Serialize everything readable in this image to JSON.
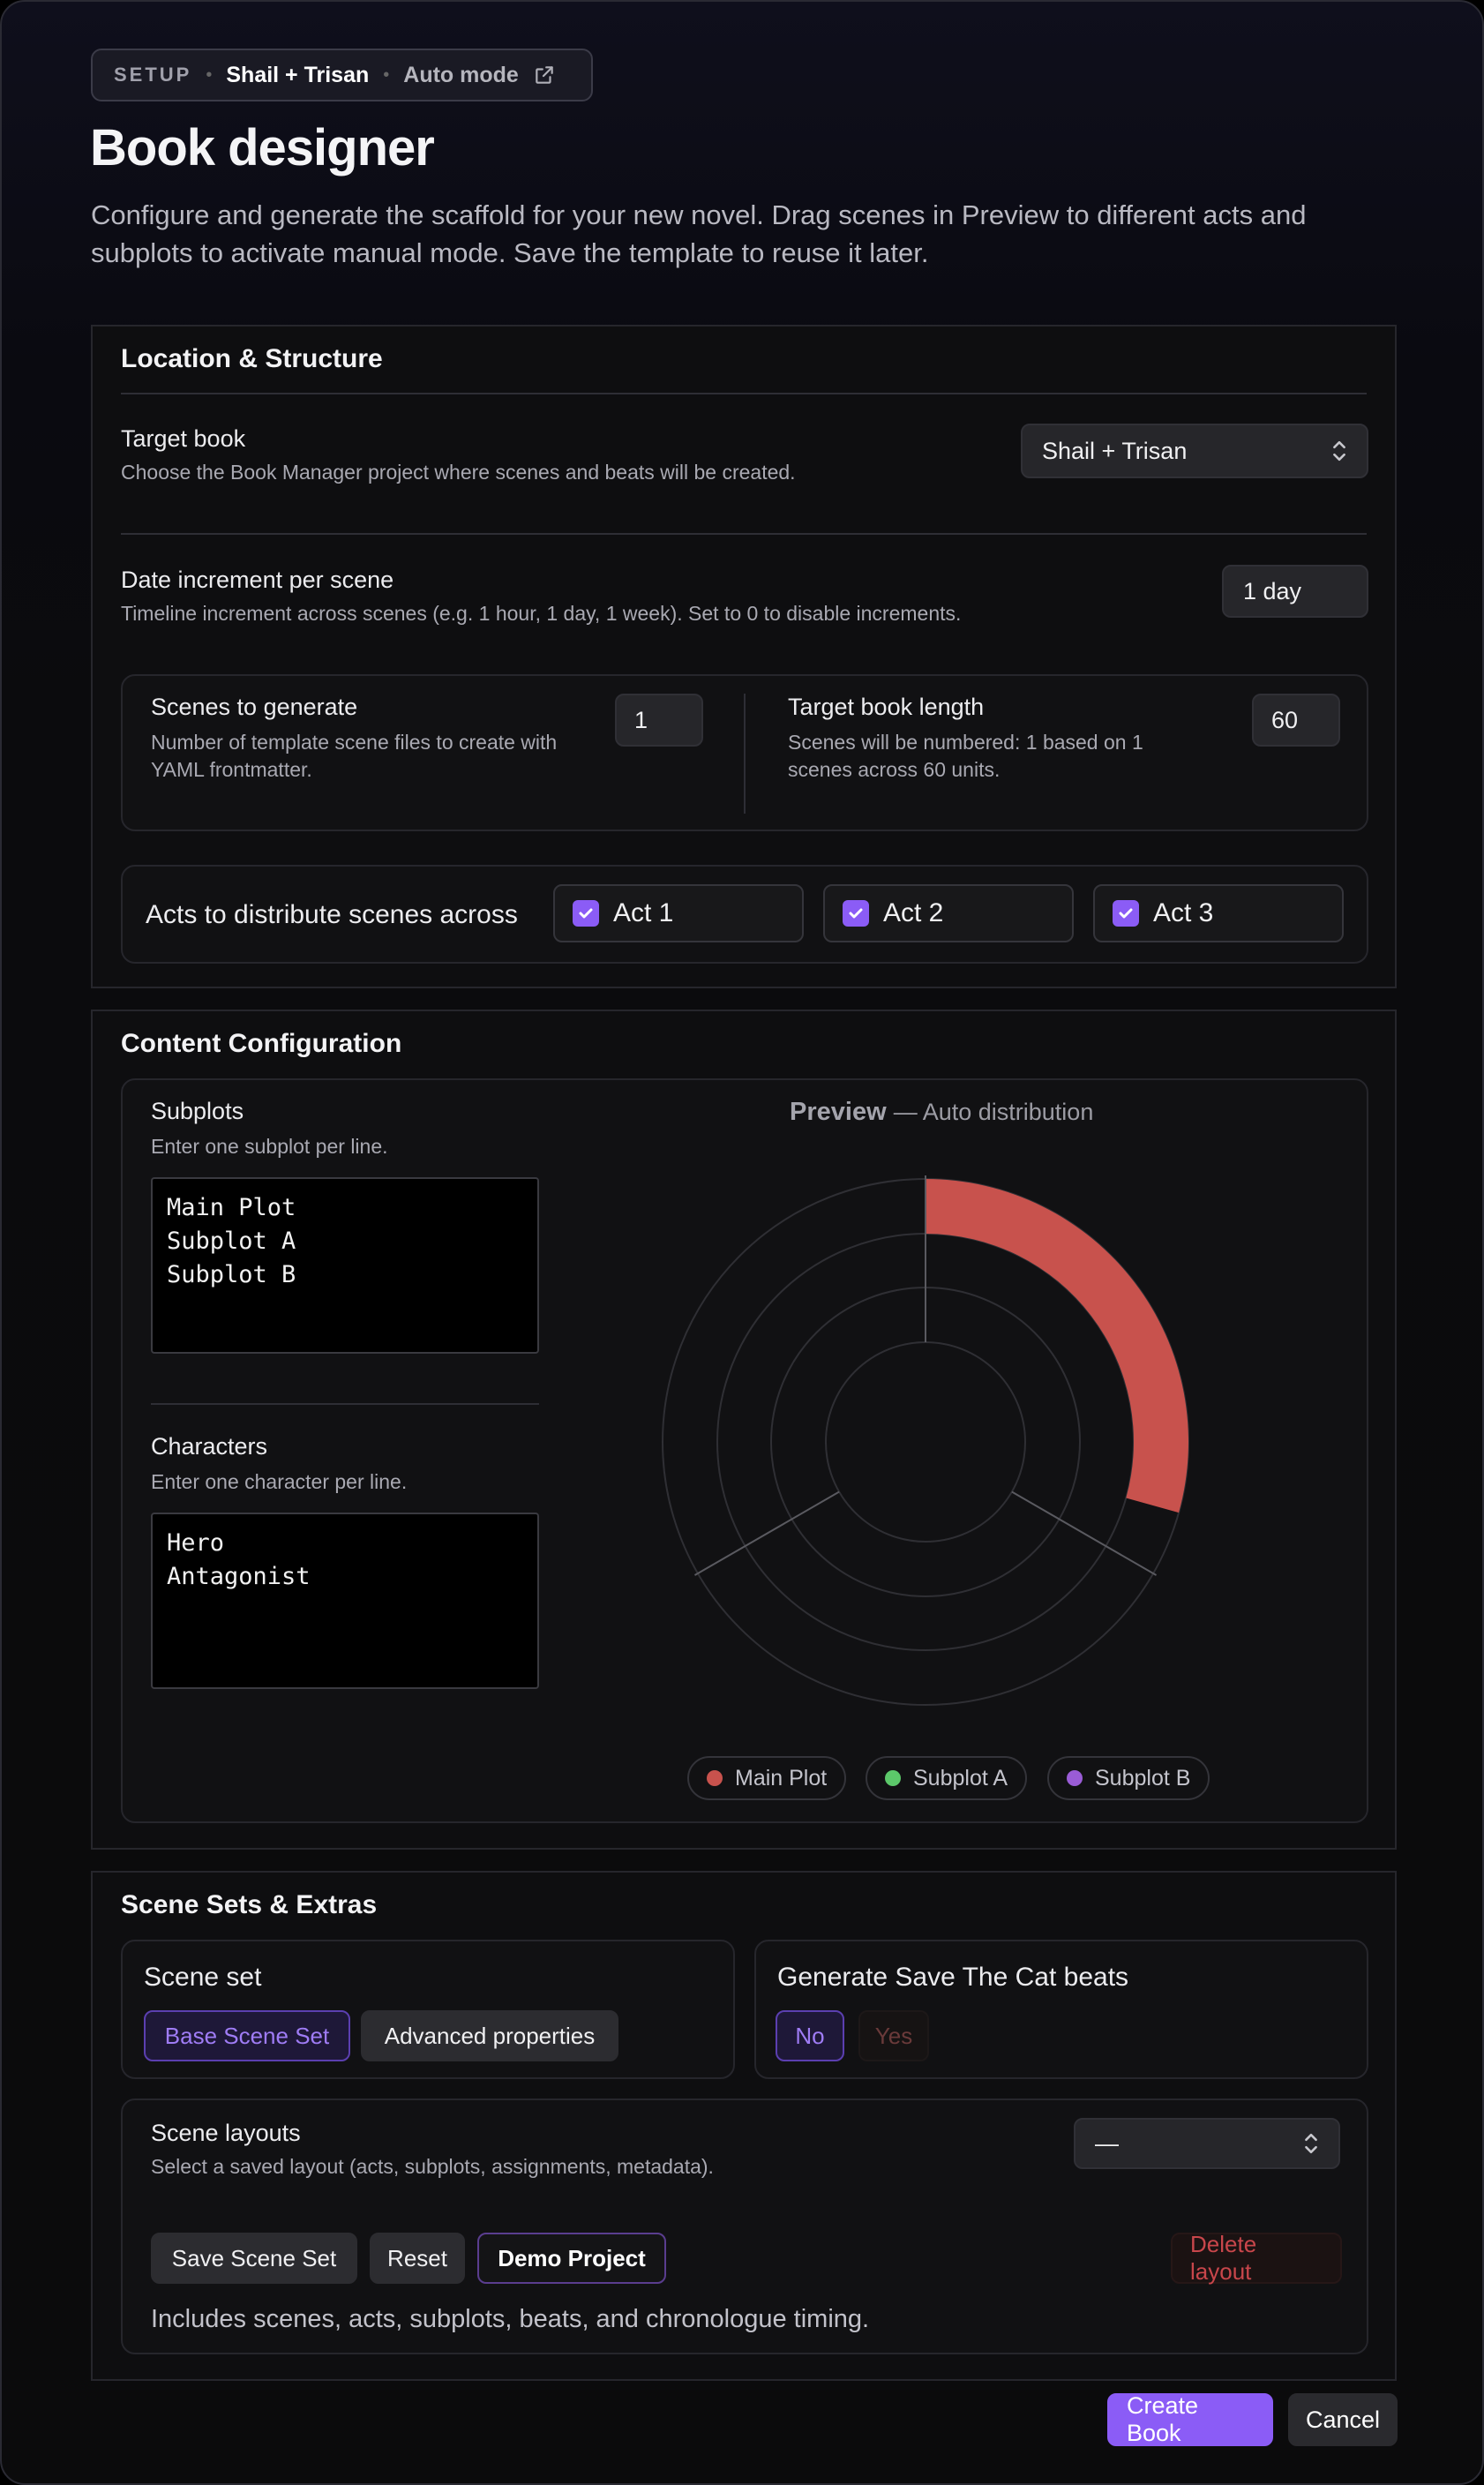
{
  "header": {
    "badge_setup": "SETUP",
    "badge_book": "Shail + Trisan",
    "badge_mode": "Auto mode",
    "title": "Book designer",
    "description": "Configure and generate the scaffold for your new novel. Drag scenes in Preview to different acts and subplots to activate manual mode. Save the template to reuse it later."
  },
  "location": {
    "title": "Location & Structure",
    "target_book_label": "Target book",
    "target_book_help": "Choose the Book Manager project where scenes and beats will be created.",
    "target_book_value": "Shail + Trisan",
    "date_inc_label": "Date increment per scene",
    "date_inc_help": "Timeline increment across scenes (e.g. 1 hour, 1 day, 1 week). Set to 0 to disable increments.",
    "date_inc_value": "1 day",
    "scenes_label": "Scenes to generate",
    "scenes_help": "Number of template scene files to create with YAML frontmatter.",
    "scenes_value": "1",
    "length_label": "Target book length",
    "length_help": "Scenes will be numbered: 1 based on 1 scenes across 60 units.",
    "length_value": "60",
    "acts_label": "Acts to distribute scenes across",
    "acts": [
      {
        "label": "Act 1",
        "checked": true
      },
      {
        "label": "Act 2",
        "checked": true
      },
      {
        "label": "Act 3",
        "checked": true
      }
    ]
  },
  "content": {
    "title": "Content Configuration",
    "subplots_label": "Subplots",
    "subplots_help": "Enter one subplot per line.",
    "subplots_value": "Main Plot\nSubplot A\nSubplot B",
    "characters_label": "Characters",
    "characters_help": "Enter one character per line.",
    "characters_value": "Hero\nAntagonist",
    "preview_title": "Preview",
    "preview_mode": "— Auto distribution",
    "legend": [
      {
        "label": "Main Plot",
        "color": "#c8524d"
      },
      {
        "label": "Subplot A",
        "color": "#5cc86a"
      },
      {
        "label": "Subplot B",
        "color": "#9a5cd6"
      }
    ]
  },
  "chart_data": {
    "type": "radial",
    "acts": 3,
    "rings": 3,
    "arcs": [
      {
        "series": "Main Plot",
        "ring": 3,
        "act": 1,
        "fraction_of_act": 0.88
      }
    ],
    "colors": {
      "Main Plot": "#c8524d"
    }
  },
  "extras": {
    "title": "Scene Sets & Extras",
    "scene_set_label": "Scene set",
    "scene_set_options": [
      "Base Scene Set",
      "Advanced properties"
    ],
    "beats_label": "Generate Save The Cat beats",
    "beats_no": "No",
    "beats_yes": "Yes",
    "layouts_label": "Scene layouts",
    "layouts_help": "Select a saved layout (acts, subplots, assignments, metadata).",
    "layouts_value": "—",
    "save_btn": "Save Scene Set",
    "reset_btn": "Reset",
    "demo_btn": "Demo Project",
    "delete_btn": "Delete layout",
    "note": "Includes scenes, acts, subplots, beats, and chronologue timing."
  },
  "footer": {
    "create": "Create Book",
    "cancel": "Cancel"
  },
  "colors": {
    "accent": "#8b5cf6",
    "danger": "#c8464b"
  }
}
